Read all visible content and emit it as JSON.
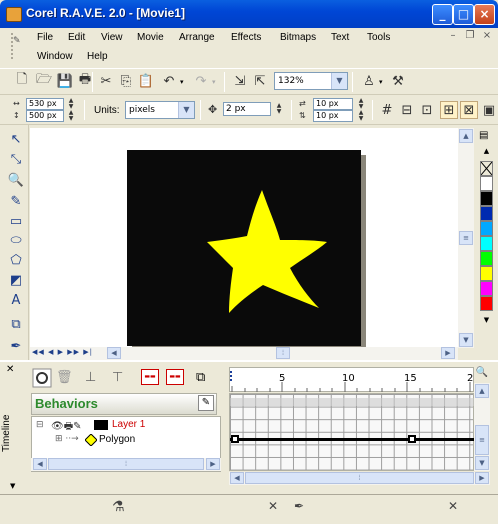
{
  "window": {
    "title": "Corel R.A.V.E. 2.0 - [Movie1]",
    "controls": [
      "minimize",
      "maximize",
      "close"
    ]
  },
  "menu": {
    "items": [
      "File",
      "Edit",
      "View",
      "Movie",
      "Arrange",
      "Effects",
      "Bitmaps",
      "Text",
      "Tools",
      "Window",
      "Help"
    ]
  },
  "standard_toolbar": {
    "zoom_value": "132%"
  },
  "property_bar": {
    "width_value": "530 px",
    "height_value": "500 px",
    "units_label": "Units:",
    "units_value": "pixels",
    "nudge_value": "2 px",
    "duplicate_x_value": "10 px",
    "duplicate_y_value": "10 px"
  },
  "stage": {
    "background_color": "#0a0a0a",
    "star_color": "#ffff00"
  },
  "palette": {
    "colors": [
      "#ffffff",
      "#ffffff",
      "#000000",
      "#002ab0",
      "#00a8ff",
      "#00ffff",
      "#00ff00",
      "#ffff00",
      "#ff00ff",
      "#ff0000",
      "#ff6600",
      "#ff3300"
    ]
  },
  "timeline": {
    "side_label": "Timeline",
    "behaviors_label": "Behaviors",
    "layers": [
      {
        "name": "Layer 1",
        "color": "#cc0000"
      },
      {
        "name": "Polygon",
        "color": "#000000"
      }
    ],
    "ruler_ticks": [
      "5",
      "10",
      "15",
      "2"
    ]
  }
}
